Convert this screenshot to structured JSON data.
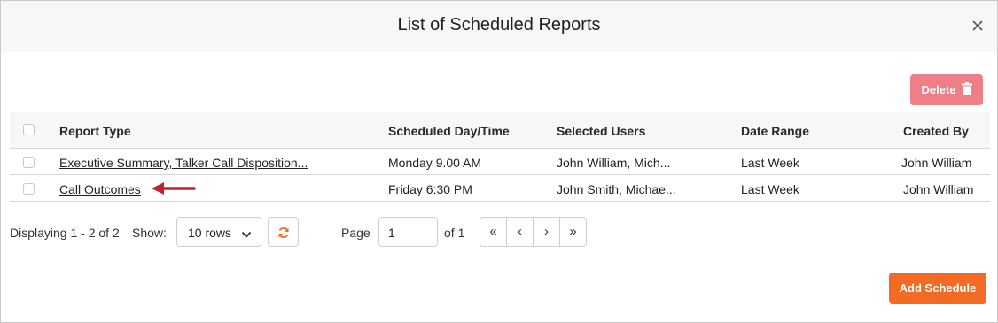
{
  "dialog": {
    "title": "List of Scheduled Reports",
    "close_icon": "close-icon"
  },
  "toolbar": {
    "delete_label": "Delete",
    "delete_icon": "trash-icon",
    "delete_color": "#ee7f87"
  },
  "table": {
    "headers": {
      "report_type": "Report Type",
      "scheduled": "Scheduled Day/Time",
      "users": "Selected Users",
      "date_range": "Date Range",
      "created_by": "Created By"
    },
    "rows": [
      {
        "report_type": "Executive Summary, Talker Call Disposition...",
        "scheduled": "Monday 9.00 AM",
        "users": "John William, Mich...",
        "date_range": "Last Week",
        "created_by": "John William"
      },
      {
        "report_type": "Call Outcomes",
        "scheduled": "Friday 6:30 PM",
        "users": "John Smith, Michae...",
        "date_range": "Last Week",
        "created_by": "John William"
      }
    ]
  },
  "annotation": {
    "arrow_icon": "left-arrow-icon",
    "arrow_color": "#c0232b"
  },
  "pagination": {
    "displaying": "Displaying 1 - 2 of 2",
    "show_label": "Show:",
    "rows_value": "10 rows",
    "page_label": "Page",
    "page_value": "1",
    "of_label": "of 1",
    "first": "«",
    "prev": "‹",
    "next": "›",
    "last": "»",
    "refresh_color": "#f36a24"
  },
  "footer": {
    "add_label": "Add Schedule",
    "add_color": "#f36a24"
  }
}
